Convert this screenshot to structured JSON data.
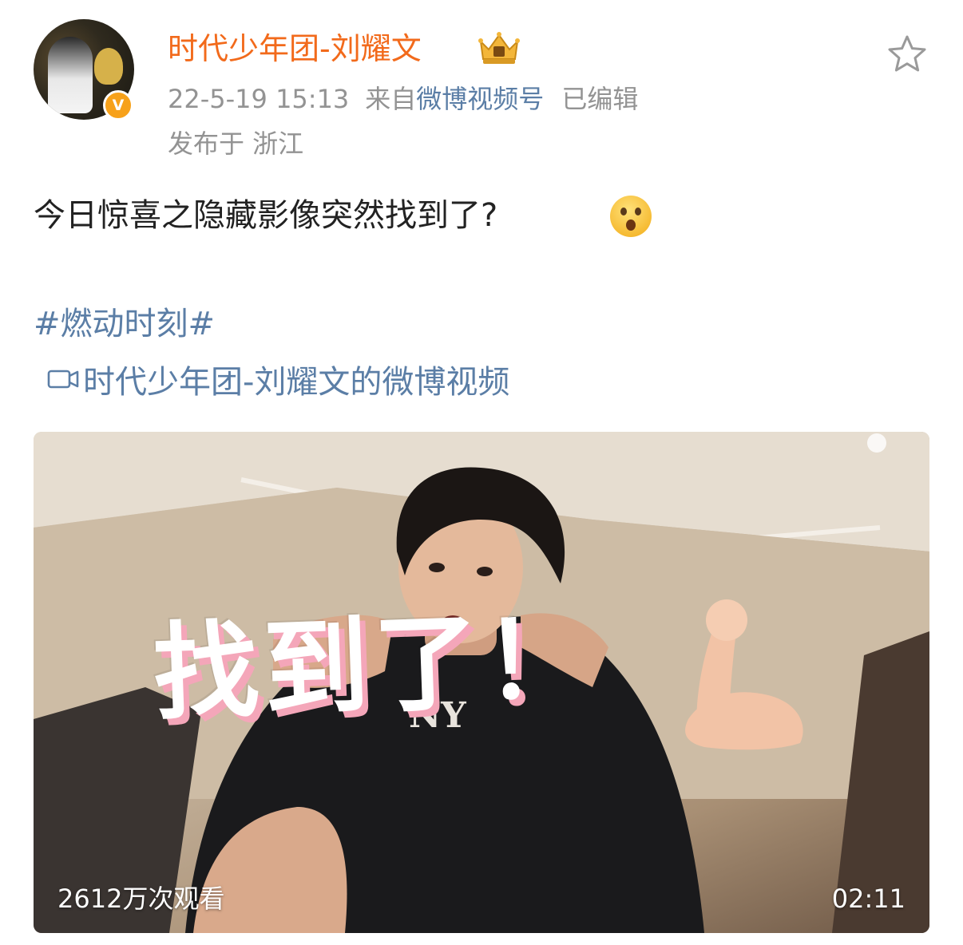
{
  "post": {
    "author": {
      "name": "时代少年团-刘耀文",
      "verified_badge": "V",
      "avatar_icon": "avatar-image",
      "crown_icon": "vip-crown-icon"
    },
    "time": "22-5-19 15:13",
    "source_prefix": "来自",
    "source": "微博视频号",
    "edited": "已编辑",
    "location": "发布于 浙江",
    "text": "今日惊喜之隐藏影像突然找到了?",
    "emoji": "surprised-face-emoji",
    "topic": "#燃动时刻#",
    "video_link": "时代少年团-刘耀文的微博视频",
    "video": {
      "overlay_text": "找到了！",
      "views": "2612万次观看",
      "duration": "02:11"
    }
  },
  "colors": {
    "username": "#f26a1b",
    "link": "#5b7ea6",
    "meta": "#939393",
    "badge": "#f7a11a",
    "overlay_shadow": "#f4a6b9"
  }
}
